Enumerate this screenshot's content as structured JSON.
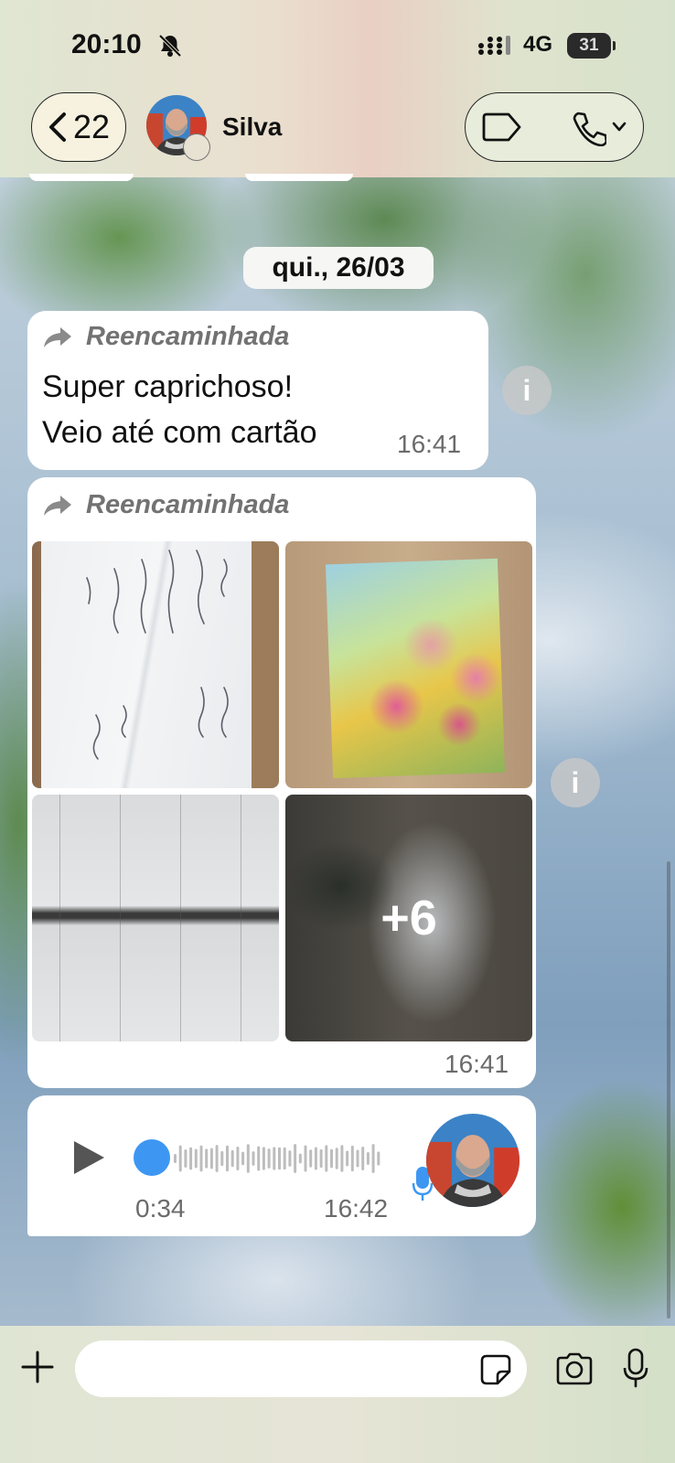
{
  "status_bar": {
    "time": "20:10",
    "network": "4G",
    "battery": "31"
  },
  "header": {
    "back_count": "22",
    "contact_name": "Silva"
  },
  "chat": {
    "date_separator": "qui., 26/03",
    "messages": [
      {
        "type": "text",
        "forwarded_label": "Reencaminhada",
        "lines": [
          "Super caprichoso!",
          "Veio até com cartão"
        ],
        "time": "16:41"
      },
      {
        "type": "album",
        "forwarded_label": "Reencaminhada",
        "photos": [
          "handwritten-card",
          "roses-painting-card",
          "diary-notebook",
          "blurred-more"
        ],
        "more_count": "+6",
        "time": "16:41"
      },
      {
        "type": "voice",
        "duration": "0:34",
        "time": "16:42",
        "progress": 0
      }
    ]
  },
  "composer": {
    "placeholder": ""
  },
  "colors": {
    "voice_accent": "#3d97f2",
    "bubble": "#ffffff",
    "muted_text": "#6b6b6b"
  }
}
